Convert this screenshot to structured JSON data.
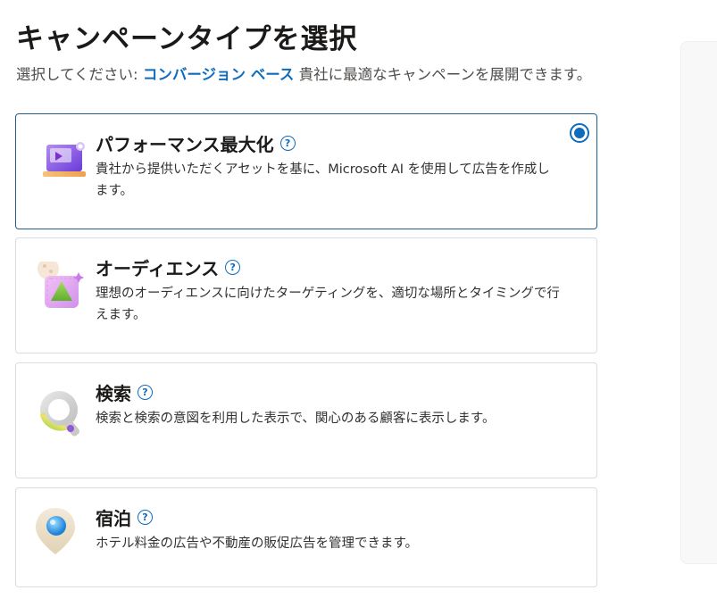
{
  "header": {
    "title": "キャンペーンタイプを選択",
    "subtitle_prefix": "選択してください: ",
    "subtitle_highlight": "コンバージョン ベース",
    "subtitle_suffix": " 貴社に最適なキャンペーンを展開できます。"
  },
  "cards": [
    {
      "title": "パフォーマンス最大化",
      "description": "貴社から提供いただくアセットを基に、Microsoft AI を使用して広告を作成します。",
      "selected": true,
      "icon": "laptop-sparkle-icon"
    },
    {
      "title": "オーディエンス",
      "description": "理想のオーディエンスに向けたターゲティングを、適切な場所とタイミングで行えます。",
      "selected": false,
      "icon": "audience-target-icon"
    },
    {
      "title": "検索",
      "description": "検索と検索の意図を利用した表示で、関心のある顧客に表示します。",
      "selected": false,
      "icon": "search-magnifier-icon"
    },
    {
      "title": "宿泊",
      "description": "ホテル料金の広告や不動産の販促広告を管理できます。",
      "selected": false,
      "icon": "location-pin-icon"
    }
  ],
  "colors": {
    "accent": "#0f6cbd",
    "selected_border": "#1f5f8f"
  }
}
